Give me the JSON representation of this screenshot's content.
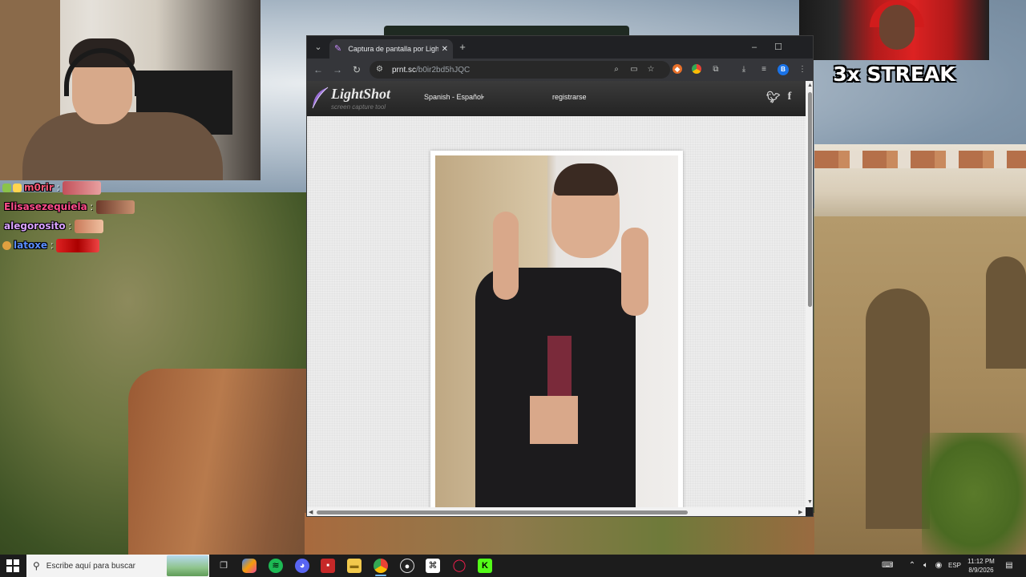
{
  "overlays": {
    "chat": [
      {
        "user": "m0rir",
        "color": "#ff5a7a",
        "badges": [
          "#8bc34a",
          "#ffd54f"
        ]
      },
      {
        "user": "Elisasezequiela",
        "color": "#ff4d8a",
        "badges": []
      },
      {
        "user": "alegorosito",
        "color": "#d9a2ff",
        "badges": []
      },
      {
        "user": "latoxe",
        "color": "#5a8dff",
        "badges": [
          "#e0a040"
        ]
      }
    ],
    "chat_colon": ":",
    "streak_text": "3x STREAK"
  },
  "browser": {
    "tab_title": "Captura de pantalla por Lightshot",
    "url_host": "prnt.sc",
    "url_path": "/b0ir2bd5hJQC",
    "profile_initial": "B",
    "icons": {
      "tab_menu": "chevron-down-icon",
      "tab_close": "close-icon",
      "new_tab": "plus-icon",
      "back": "back-arrow-icon",
      "forward": "forward-arrow-icon",
      "reload": "reload-icon",
      "zoom": "zoom-icon",
      "cast": "cast-icon",
      "bookmark": "star-icon",
      "extensions": "puzzle-icon",
      "downloads": "download-icon",
      "reading_list": "reading-list-icon",
      "menu": "kebab-menu-icon"
    }
  },
  "lightshot": {
    "logo_text": "LightShot",
    "logo_subtitle": "screen capture tool",
    "language": "Spanish - Español",
    "register": "registrarse"
  },
  "taskbar": {
    "search_placeholder": "Escribe aquí para buscar",
    "language": "ESP",
    "time": "11:12 PM",
    "date": "8/9/2026",
    "apps": [
      "task-view",
      "copilot",
      "spotify",
      "discord",
      "news",
      "file-explorer",
      "chrome",
      "obs",
      "capcut",
      "opera-gx",
      "kick"
    ]
  },
  "colors": {
    "chrome_bg": "#202124",
    "chrome_toolbar": "#35363a",
    "lightshot_header": "#2a2a2a",
    "taskbar_bg": "#1c1c1c",
    "accent": "#1a73e8"
  }
}
